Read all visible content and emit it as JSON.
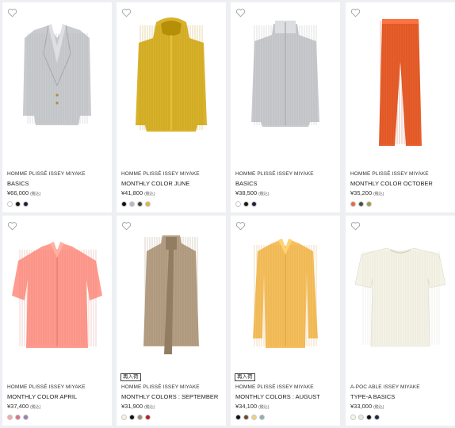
{
  "products": [
    {
      "brand": "HOMME PLISSÉ ISSEY MIYAKE",
      "name": "BASICS",
      "price": "¥66,000",
      "tax": "(税込)",
      "badge": "",
      "swatches": [
        "#ffffff",
        "#1a1a1a",
        "#1c2340"
      ],
      "item_color": "#c9cbcf",
      "item_type": "jacket"
    },
    {
      "brand": "HOMME PLISSÉ ISSEY MIYAKE",
      "name": "MONTHLY COLOR JUNE",
      "price": "¥41,800",
      "tax": "(税込)",
      "badge": "",
      "swatches": [
        "#111111",
        "#b7b7bd",
        "#4a4036",
        "#e0b43a"
      ],
      "item_color": "#d9b22c",
      "item_type": "hoodie"
    },
    {
      "brand": "HOMME PLISSÉ ISSEY MIYAKE",
      "name": "BASICS",
      "price": "¥38,500",
      "tax": "(税込)",
      "badge": "",
      "swatches": [
        "#ffffff",
        "#1a1a1a",
        "#1c2340"
      ],
      "item_color": "#c8cacd",
      "item_type": "zipjacket"
    },
    {
      "brand": "HOMME PLISSÉ ISSEY MIYAKE",
      "name": "MONTHLY COLOR OCTOBER",
      "price": "¥35,200",
      "tax": "(税込)",
      "badge": "",
      "swatches": [
        "#ea6a3a",
        "#47513e",
        "#a09a4e"
      ],
      "item_color": "#e65f2c",
      "item_type": "pants"
    },
    {
      "brand": "HOMME PLISSÉ ISSEY MIYAKE",
      "name": "MONTHLY COLOR APRIL",
      "price": "¥37,400",
      "tax": "(税込)",
      "badge": "",
      "swatches": [
        "#f7a6a6",
        "#d9708a",
        "#9a7fb4"
      ],
      "item_color": "#ff9c8f",
      "item_type": "shirt"
    },
    {
      "brand": "HOMME PLISSÉ ISSEY MIYAKE",
      "name": "MONTHLY COLORS : SEPTEMBER",
      "price": "¥31,900",
      "tax": "(税込)",
      "badge": "再入荷",
      "swatches": [
        "#fbf2dc",
        "#111111",
        "#a08c72",
        "#b71e1e"
      ],
      "item_color": "#b6a085",
      "item_type": "vest"
    },
    {
      "brand": "HOMME PLISSÉ ISSEY MIYAKE",
      "name": "MONTHLY COLORS : AUGUST",
      "price": "¥34,100",
      "tax": "(税込)",
      "badge": "再入荷",
      "swatches": [
        "#111111",
        "#6b4a2c",
        "#f2cf7a",
        "#8cb0b3"
      ],
      "item_color": "#f6bf5e",
      "item_type": "longshirt"
    },
    {
      "brand": "A-POC ABLE ISSEY MIYAKE",
      "name": "TYPE-A BASICS",
      "price": "¥33,000",
      "tax": "(税込)",
      "badge": "",
      "swatches": [
        "#fbf4e6",
        "#e6e6e6",
        "#111111",
        "#1f2a46"
      ],
      "item_color": "#f4f3e6",
      "item_type": "tee"
    }
  ]
}
